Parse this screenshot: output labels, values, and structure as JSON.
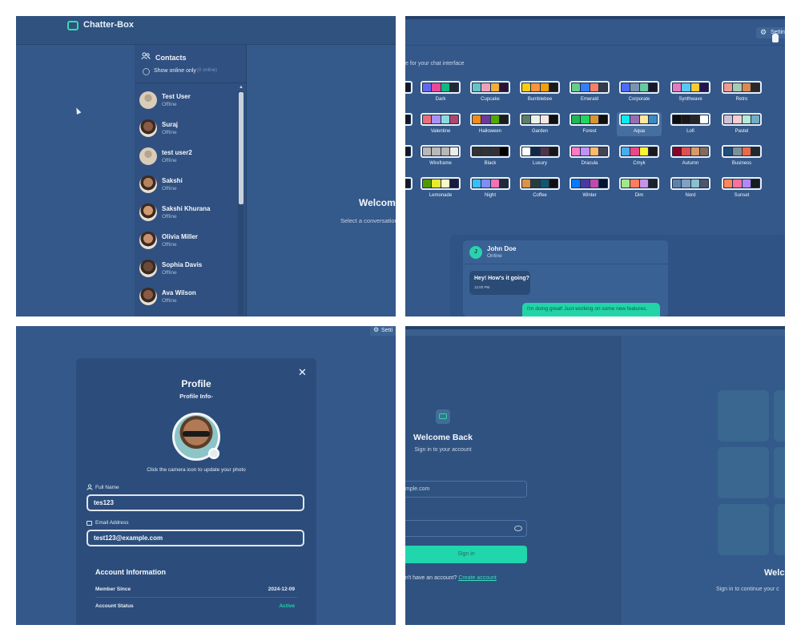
{
  "panel1": {
    "brand": "Chatter-Box",
    "contacts_label": "Contacts",
    "show_online": "Show online only",
    "online_count": "(0 online)",
    "contacts": [
      {
        "name": "Test User",
        "status": "Offline",
        "avatar": "placeholder"
      },
      {
        "name": "Suraj",
        "status": "Offline",
        "avatar": "photo"
      },
      {
        "name": "test user2",
        "status": "Offline",
        "avatar": "placeholder"
      },
      {
        "name": "Sakshi",
        "status": "Offline",
        "avatar": "photo"
      },
      {
        "name": "Sakshi Khurana",
        "status": "Offline",
        "avatar": "photo"
      },
      {
        "name": "Olivia Miller",
        "status": "Offline",
        "avatar": "photo"
      },
      {
        "name": "Sophia Davis",
        "status": "Offline",
        "avatar": "photo"
      },
      {
        "name": "Ava Wilson",
        "status": "Offline",
        "avatar": "photo"
      }
    ],
    "welcome": "Welcom",
    "welcome_sub": "Select a conversation"
  },
  "panel2": {
    "settings": "Settin",
    "theme_subtitle": "e for your chat interface",
    "themes": [
      {
        "name": "",
        "colors": [
          "#f2f2f2",
          "#c8c8c8",
          "#1f2937",
          "#111827"
        ]
      },
      {
        "name": "Dark",
        "colors": [
          "#6366f1",
          "#ec4899",
          "#10b981",
          "#1f2937"
        ]
      },
      {
        "name": "Cupcake",
        "colors": [
          "#65c3c8",
          "#ef9fbc",
          "#eeaf3a",
          "#291334"
        ]
      },
      {
        "name": "Bumblebee",
        "colors": [
          "#facc15",
          "#fb923c",
          "#f59e0b",
          "#1c1917"
        ]
      },
      {
        "name": "Emerald",
        "colors": [
          "#66cc8a",
          "#377cfb",
          "#f68067",
          "#333c4d"
        ]
      },
      {
        "name": "Corporate",
        "colors": [
          "#4b6bfb",
          "#7b92b2",
          "#67cba0",
          "#181a2a"
        ]
      },
      {
        "name": "Synthwave",
        "colors": [
          "#e779c1",
          "#58c7f3",
          "#f3cc30",
          "#221551"
        ]
      },
      {
        "name": "Retro",
        "colors": [
          "#ef9995",
          "#a4cbb4",
          "#dc8850",
          "#2e282a"
        ]
      },
      {
        "name": "",
        "colors": [
          "#f59e0b",
          "#f59e0b",
          "#1f2937",
          "#111827"
        ]
      },
      {
        "name": "Valentine",
        "colors": [
          "#e96d7b",
          "#a991f7",
          "#88dbdd",
          "#af4670"
        ]
      },
      {
        "name": "Halloween",
        "colors": [
          "#f28c18",
          "#6d3a9c",
          "#51a800",
          "#1b1d1d"
        ]
      },
      {
        "name": "Garden",
        "colors": [
          "#5c7f67",
          "#ecf4e7",
          "#fae5e5",
          "#100f0f"
        ]
      },
      {
        "name": "Forest",
        "colors": [
          "#1eb854",
          "#1fd65f",
          "#d99330",
          "#110e0e"
        ]
      },
      {
        "name": "Aqua",
        "colors": [
          "#09ecf3",
          "#966fb3",
          "#ffe999",
          "#3b8ac4"
        ]
      },
      {
        "name": "Lofi",
        "colors": [
          "#0d0d0d",
          "#1a1919",
          "#262626",
          "#ffffff"
        ]
      },
      {
        "name": "Pastel",
        "colors": [
          "#d1c1d7",
          "#f6cbd1",
          "#b4e9d6",
          "#70acc7"
        ]
      },
      {
        "name": "",
        "colors": [
          "#1f2937",
          "#d1d5db",
          "#6b7280",
          "#111827"
        ]
      },
      {
        "name": "Wireframe",
        "colors": [
          "#b8b8b8",
          "#b8b8b8",
          "#b8b8b8",
          "#ebebeb"
        ]
      },
      {
        "name": "Black",
        "colors": [
          "#343232",
          "#343232",
          "#343232",
          "#000000"
        ]
      },
      {
        "name": "Luxury",
        "colors": [
          "#ffffff",
          "#152747",
          "#513448",
          "#171618"
        ]
      },
      {
        "name": "Dracula",
        "colors": [
          "#ff79c6",
          "#bd93f9",
          "#ffb86c",
          "#414558"
        ]
      },
      {
        "name": "Cmyk",
        "colors": [
          "#45aeee",
          "#e8488a",
          "#fff232",
          "#1a1a1a"
        ]
      },
      {
        "name": "Autumn",
        "colors": [
          "#8c0327",
          "#d85251",
          "#d59b6a",
          "#826a5c"
        ]
      },
      {
        "name": "Business",
        "colors": [
          "#1c4e80",
          "#7c909a",
          "#ea6947",
          "#23282e"
        ]
      },
      {
        "name": "",
        "colors": [
          "#dc2626",
          "#f59e0b",
          "#1f2937",
          "#111827"
        ]
      },
      {
        "name": "Lemonade",
        "colors": [
          "#519903",
          "#e9e92e",
          "#f7f9ca",
          "#191a3e"
        ]
      },
      {
        "name": "Night",
        "colors": [
          "#38bdf8",
          "#818cf8",
          "#f471b5",
          "#1e293b"
        ]
      },
      {
        "name": "Coffee",
        "colors": [
          "#db924b",
          "#263e3f",
          "#10576d",
          "#120c12"
        ]
      },
      {
        "name": "Winter",
        "colors": [
          "#047aff",
          "#463aa2",
          "#c148ac",
          "#021431"
        ]
      },
      {
        "name": "Dim",
        "colors": [
          "#9fe88d",
          "#ff7d5c",
          "#c792e9",
          "#1c212b"
        ]
      },
      {
        "name": "Nord",
        "colors": [
          "#5e81ac",
          "#81a1c1",
          "#88c0d0",
          "#4c566a"
        ]
      },
      {
        "name": "Sunset",
        "colors": [
          "#ff865b",
          "#fd6f9c",
          "#b387fa",
          "#121c22"
        ]
      }
    ],
    "selected_theme": "Aqua",
    "preview": {
      "name": "John Doe",
      "initial": "J",
      "status": "Online",
      "incoming": "Hey! How's it going?",
      "incoming_time": "12:00 PM",
      "outgoing": "I'm doing great! Just working on some new features."
    }
  },
  "panel3": {
    "settings": "Setti",
    "title": "Profile",
    "subtitle": "Profile Info-",
    "hint": "Click the camera icon to update your photo",
    "fullname_label": "Full Name",
    "fullname_value": "tes123",
    "email_label": "Email Address",
    "email_value": "test123@example.com",
    "account_title": "Account Information",
    "member_since_label": "Member Since",
    "member_since_value": "2024-12-09",
    "status_label": "Account Status",
    "status_value": "Active",
    "status_color": "#22d4a8"
  },
  "panel4": {
    "heading": "Welcome Back",
    "sub": "Sign in to your account",
    "email_value": "mple.com",
    "signin": "Sign in",
    "noacct": "n't have an account?",
    "create": "Create account",
    "welcome_right": "Welc",
    "welcome_right_sub": "Sign in to continue your c"
  },
  "colors": {
    "accent": "#22d4a8",
    "panel_bg": "#34588a"
  }
}
